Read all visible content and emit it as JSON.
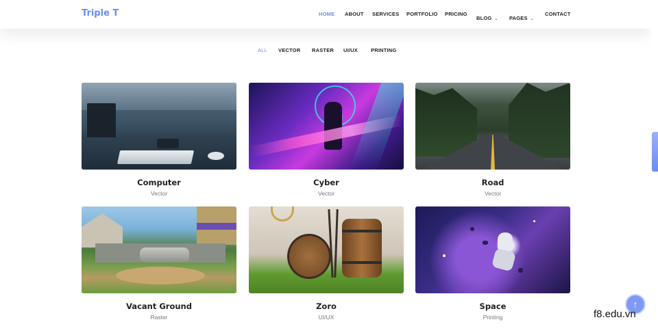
{
  "header": {
    "logo": "Triple T",
    "nav": [
      {
        "label": "HOME",
        "active": true
      },
      {
        "label": "ABOUT"
      },
      {
        "label": "SERVICES"
      },
      {
        "label": "PORTFOLIO"
      },
      {
        "label": "PRICING"
      },
      {
        "label": "BLOG",
        "dropdown": true
      },
      {
        "label": "PAGES",
        "dropdown": true
      },
      {
        "label": "CONTACT"
      }
    ],
    "chevron_icon": "chevron-down-icon"
  },
  "filters": [
    {
      "label": "ALL",
      "active": true
    },
    {
      "label": "VECTOR"
    },
    {
      "label": "RASTER"
    },
    {
      "label": "UI/UX"
    },
    {
      "label": "PRINTING"
    }
  ],
  "portfolio": [
    {
      "title": "Computer",
      "category": "Vector"
    },
    {
      "title": "Cyber",
      "category": "Vector"
    },
    {
      "title": "Road",
      "category": "Vector"
    },
    {
      "title": "Vacant Ground",
      "category": "Raster"
    },
    {
      "title": "Zoro",
      "category": "UI/UX"
    },
    {
      "title": "Space",
      "category": "Printing"
    }
  ],
  "scroll_top": {
    "icon": "arrow-up-icon",
    "glyph": "↑"
  },
  "watermark": "f8.edu.vn",
  "colors": {
    "accent": "#6d8cf0",
    "text": "#222222",
    "muted": "#777777"
  }
}
